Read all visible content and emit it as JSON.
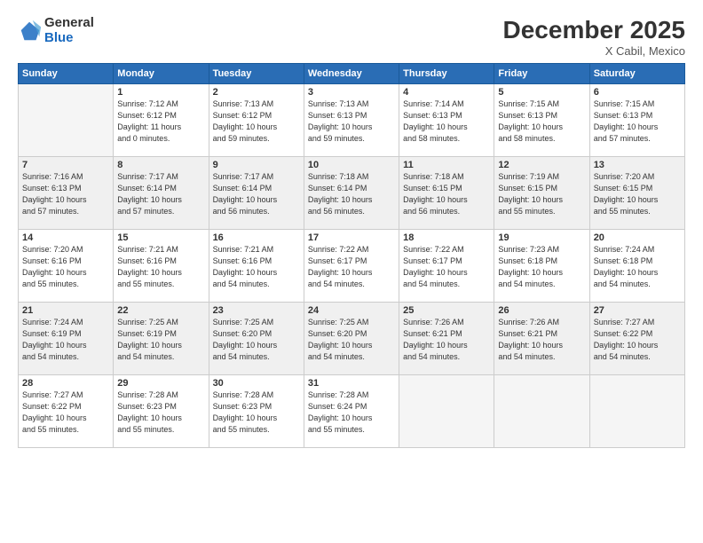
{
  "logo": {
    "general": "General",
    "blue": "Blue"
  },
  "header": {
    "month": "December 2025",
    "location": "X Cabil, Mexico"
  },
  "weekdays": [
    "Sunday",
    "Monday",
    "Tuesday",
    "Wednesday",
    "Thursday",
    "Friday",
    "Saturday"
  ],
  "weeks": [
    [
      {
        "day": "",
        "sunrise": "",
        "sunset": "",
        "daylight": ""
      },
      {
        "day": "1",
        "sunrise": "Sunrise: 7:12 AM",
        "sunset": "Sunset: 6:12 PM",
        "daylight": "Daylight: 11 hours and 0 minutes."
      },
      {
        "day": "2",
        "sunrise": "Sunrise: 7:13 AM",
        "sunset": "Sunset: 6:12 PM",
        "daylight": "Daylight: 10 hours and 59 minutes."
      },
      {
        "day": "3",
        "sunrise": "Sunrise: 7:13 AM",
        "sunset": "Sunset: 6:13 PM",
        "daylight": "Daylight: 10 hours and 59 minutes."
      },
      {
        "day": "4",
        "sunrise": "Sunrise: 7:14 AM",
        "sunset": "Sunset: 6:13 PM",
        "daylight": "Daylight: 10 hours and 58 minutes."
      },
      {
        "day": "5",
        "sunrise": "Sunrise: 7:15 AM",
        "sunset": "Sunset: 6:13 PM",
        "daylight": "Daylight: 10 hours and 58 minutes."
      },
      {
        "day": "6",
        "sunrise": "Sunrise: 7:15 AM",
        "sunset": "Sunset: 6:13 PM",
        "daylight": "Daylight: 10 hours and 57 minutes."
      }
    ],
    [
      {
        "day": "7",
        "sunrise": "Sunrise: 7:16 AM",
        "sunset": "Sunset: 6:13 PM",
        "daylight": "Daylight: 10 hours and 57 minutes."
      },
      {
        "day": "8",
        "sunrise": "Sunrise: 7:17 AM",
        "sunset": "Sunset: 6:14 PM",
        "daylight": "Daylight: 10 hours and 57 minutes."
      },
      {
        "day": "9",
        "sunrise": "Sunrise: 7:17 AM",
        "sunset": "Sunset: 6:14 PM",
        "daylight": "Daylight: 10 hours and 56 minutes."
      },
      {
        "day": "10",
        "sunrise": "Sunrise: 7:18 AM",
        "sunset": "Sunset: 6:14 PM",
        "daylight": "Daylight: 10 hours and 56 minutes."
      },
      {
        "day": "11",
        "sunrise": "Sunrise: 7:18 AM",
        "sunset": "Sunset: 6:15 PM",
        "daylight": "Daylight: 10 hours and 56 minutes."
      },
      {
        "day": "12",
        "sunrise": "Sunrise: 7:19 AM",
        "sunset": "Sunset: 6:15 PM",
        "daylight": "Daylight: 10 hours and 55 minutes."
      },
      {
        "day": "13",
        "sunrise": "Sunrise: 7:20 AM",
        "sunset": "Sunset: 6:15 PM",
        "daylight": "Daylight: 10 hours and 55 minutes."
      }
    ],
    [
      {
        "day": "14",
        "sunrise": "Sunrise: 7:20 AM",
        "sunset": "Sunset: 6:16 PM",
        "daylight": "Daylight: 10 hours and 55 minutes."
      },
      {
        "day": "15",
        "sunrise": "Sunrise: 7:21 AM",
        "sunset": "Sunset: 6:16 PM",
        "daylight": "Daylight: 10 hours and 55 minutes."
      },
      {
        "day": "16",
        "sunrise": "Sunrise: 7:21 AM",
        "sunset": "Sunset: 6:16 PM",
        "daylight": "Daylight: 10 hours and 54 minutes."
      },
      {
        "day": "17",
        "sunrise": "Sunrise: 7:22 AM",
        "sunset": "Sunset: 6:17 PM",
        "daylight": "Daylight: 10 hours and 54 minutes."
      },
      {
        "day": "18",
        "sunrise": "Sunrise: 7:22 AM",
        "sunset": "Sunset: 6:17 PM",
        "daylight": "Daylight: 10 hours and 54 minutes."
      },
      {
        "day": "19",
        "sunrise": "Sunrise: 7:23 AM",
        "sunset": "Sunset: 6:18 PM",
        "daylight": "Daylight: 10 hours and 54 minutes."
      },
      {
        "day": "20",
        "sunrise": "Sunrise: 7:24 AM",
        "sunset": "Sunset: 6:18 PM",
        "daylight": "Daylight: 10 hours and 54 minutes."
      }
    ],
    [
      {
        "day": "21",
        "sunrise": "Sunrise: 7:24 AM",
        "sunset": "Sunset: 6:19 PM",
        "daylight": "Daylight: 10 hours and 54 minutes."
      },
      {
        "day": "22",
        "sunrise": "Sunrise: 7:25 AM",
        "sunset": "Sunset: 6:19 PM",
        "daylight": "Daylight: 10 hours and 54 minutes."
      },
      {
        "day": "23",
        "sunrise": "Sunrise: 7:25 AM",
        "sunset": "Sunset: 6:20 PM",
        "daylight": "Daylight: 10 hours and 54 minutes."
      },
      {
        "day": "24",
        "sunrise": "Sunrise: 7:25 AM",
        "sunset": "Sunset: 6:20 PM",
        "daylight": "Daylight: 10 hours and 54 minutes."
      },
      {
        "day": "25",
        "sunrise": "Sunrise: 7:26 AM",
        "sunset": "Sunset: 6:21 PM",
        "daylight": "Daylight: 10 hours and 54 minutes."
      },
      {
        "day": "26",
        "sunrise": "Sunrise: 7:26 AM",
        "sunset": "Sunset: 6:21 PM",
        "daylight": "Daylight: 10 hours and 54 minutes."
      },
      {
        "day": "27",
        "sunrise": "Sunrise: 7:27 AM",
        "sunset": "Sunset: 6:22 PM",
        "daylight": "Daylight: 10 hours and 54 minutes."
      }
    ],
    [
      {
        "day": "28",
        "sunrise": "Sunrise: 7:27 AM",
        "sunset": "Sunset: 6:22 PM",
        "daylight": "Daylight: 10 hours and 55 minutes."
      },
      {
        "day": "29",
        "sunrise": "Sunrise: 7:28 AM",
        "sunset": "Sunset: 6:23 PM",
        "daylight": "Daylight: 10 hours and 55 minutes."
      },
      {
        "day": "30",
        "sunrise": "Sunrise: 7:28 AM",
        "sunset": "Sunset: 6:23 PM",
        "daylight": "Daylight: 10 hours and 55 minutes."
      },
      {
        "day": "31",
        "sunrise": "Sunrise: 7:28 AM",
        "sunset": "Sunset: 6:24 PM",
        "daylight": "Daylight: 10 hours and 55 minutes."
      },
      {
        "day": "",
        "sunrise": "",
        "sunset": "",
        "daylight": ""
      },
      {
        "day": "",
        "sunrise": "",
        "sunset": "",
        "daylight": ""
      },
      {
        "day": "",
        "sunrise": "",
        "sunset": "",
        "daylight": ""
      }
    ]
  ]
}
